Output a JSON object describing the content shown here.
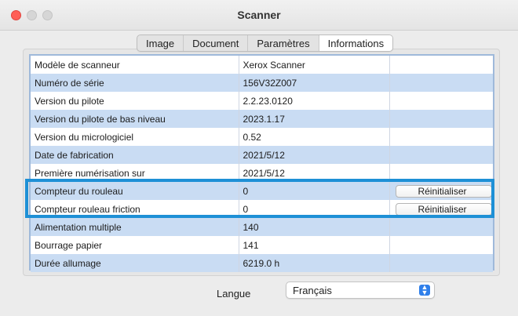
{
  "window": {
    "title": "Scanner"
  },
  "tabs": [
    {
      "label": "Image",
      "active": false
    },
    {
      "label": "Document",
      "active": false
    },
    {
      "label": "Paramètres",
      "active": false
    },
    {
      "label": "Informations",
      "active": true
    }
  ],
  "info_rows": [
    {
      "label": "Modèle de scanneur",
      "value": "Xerox Scanner"
    },
    {
      "label": "Numéro de série",
      "value": "156V32Z007"
    },
    {
      "label": "Version du pilote",
      "value": "2.2.23.0120"
    },
    {
      "label": "Version du pilote de bas niveau",
      "value": "2023.1.17"
    },
    {
      "label": "Version du micrologiciel",
      "value": "0.52"
    },
    {
      "label": "Date de fabrication",
      "value": "2021/5/12"
    },
    {
      "label": "Première numérisation sur",
      "value": "2021/5/12"
    },
    {
      "label": "Compteur du rouleau",
      "value": "0",
      "button": "Réinitialiser"
    },
    {
      "label": "Compteur rouleau friction",
      "value": "0",
      "button": "Réinitialiser"
    },
    {
      "label": "Alimentation multiple",
      "value": "140"
    },
    {
      "label": "Bourrage papier",
      "value": "141"
    },
    {
      "label": "Durée allumage",
      "value": "6219.0 h"
    }
  ],
  "language": {
    "label": "Langue",
    "selected": "Français"
  },
  "colors": {
    "row_alt": "#c9dcf3",
    "highlight_border": "#1e90d6",
    "close_button": "#ff5f57",
    "select_arrow": "#2f7fea"
  },
  "icons": {
    "select_arrow": "chevron-up-down-icon"
  }
}
